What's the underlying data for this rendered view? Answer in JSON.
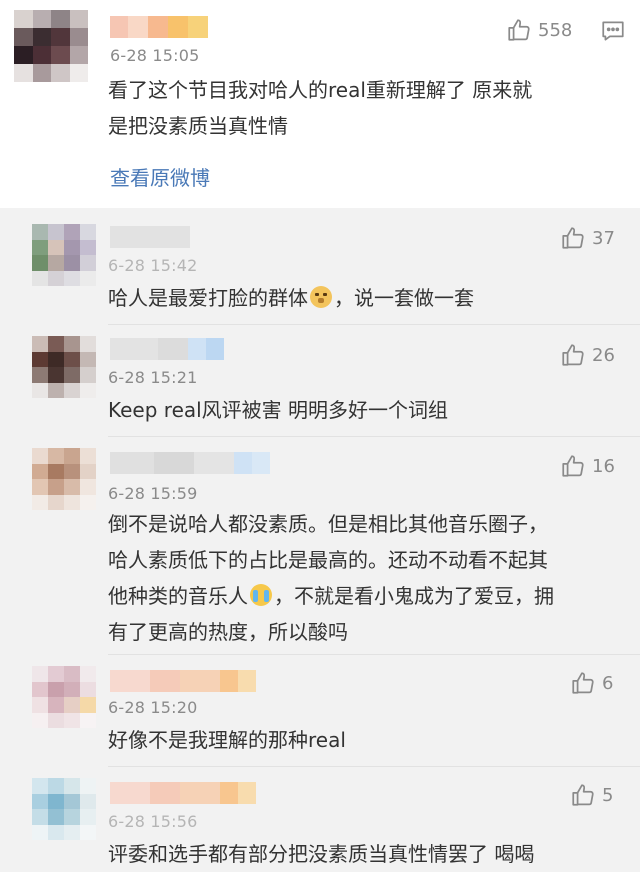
{
  "main_comment": {
    "time": "6-28 15:05",
    "like_count": "558",
    "text_line1": "看了这个节目我对哈人的real重新理解了 原来就",
    "text_line2": "是把没素质当真性情",
    "view_original": "查看原微博"
  },
  "replies": [
    {
      "time": "6-28 15:42",
      "like_count": "37",
      "text_before_emoji": "哈人是最爱打脸的群体",
      "emoji": "doge-emoji",
      "text_after_emoji": "，说一套做一套"
    },
    {
      "time": "6-28 15:21",
      "like_count": "26",
      "text": "Keep real风评被害 明明多好一个词组"
    },
    {
      "time": "6-28 15:59",
      "like_count": "16",
      "text_line1": "倒不是说哈人都没素质。但是相比其他音乐圈子，",
      "text_line2": "哈人素质低下的占比是最高的。还动不动看不起其",
      "text_line3_before_emoji": "他种类的音乐人",
      "emoji": "crying-emoji",
      "text_line3_after_emoji": "，不就是看小鬼成为了爱豆，拥",
      "text_line4": "有了更高的热度，所以酸吗"
    },
    {
      "time": "6-28 15:20",
      "like_count": "6",
      "text": "好像不是我理解的那种real"
    },
    {
      "time": "6-28 15:56",
      "like_count": "5",
      "text": "评委和选手都有部分把没素质当真性情罢了 喝喝"
    }
  ],
  "colors": {
    "link": "#4a79b7",
    "meta_gray": "#8a8a8a",
    "reply_background": "#f2f2f2",
    "main_background": "#ffffff"
  }
}
